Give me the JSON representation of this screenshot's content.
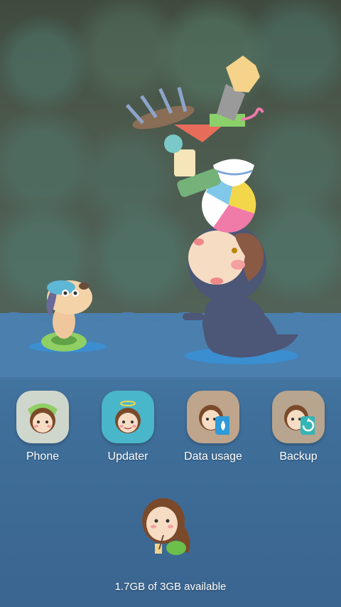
{
  "wallpaper": {
    "sky_color": "#4a5a49",
    "water_color": "#3f6f9a"
  },
  "dock": {
    "apps": [
      {
        "label": "Phone",
        "icon": "phone-girl-icon",
        "bg": "#cfd6cc"
      },
      {
        "label": "Updater",
        "icon": "angel-girl-icon",
        "bg": "#4ab6c9"
      },
      {
        "label": "Data usage",
        "icon": "data-usage-girl-icon",
        "bg": "#bfa58c"
      },
      {
        "label": "Backup",
        "icon": "backup-girl-icon",
        "bg": "#b7a58f"
      }
    ]
  },
  "storage": {
    "status_text": "1.7GB of 3GB available"
  },
  "widget": {
    "icon": "girl-sweeping-icon"
  }
}
